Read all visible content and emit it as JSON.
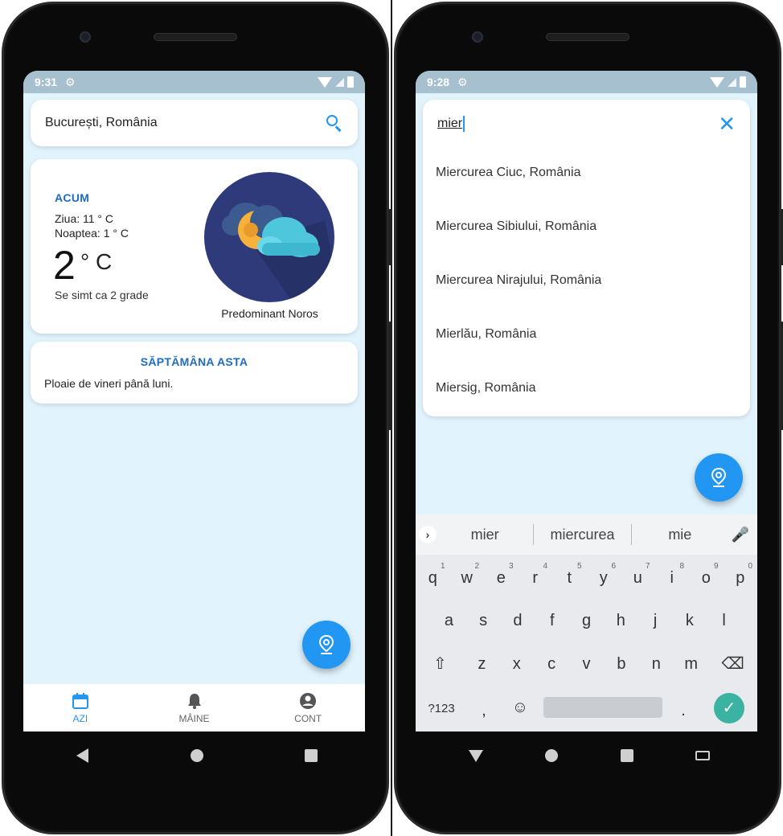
{
  "left_phone": {
    "status": {
      "time": "9:31"
    },
    "search": {
      "location": "București, România"
    },
    "now": {
      "heading": "ACUM",
      "day": "Ziua: 11 ° C",
      "night": "Noaptea: 1 ° C",
      "temp": "2",
      "unit": "° C",
      "feels_like": "Se simt ca 2 grade",
      "condition": "Predominant Noros"
    },
    "week": {
      "heading": "SĂPTĂMÂNA ASTA",
      "text": "Ploaie de vineri până luni."
    },
    "bottom_nav": [
      {
        "label": "AZI",
        "icon": "calendar-icon",
        "active": true
      },
      {
        "label": "MÂINE",
        "icon": "bell-icon",
        "active": false
      },
      {
        "label": "CONT",
        "icon": "account-icon",
        "active": false
      }
    ]
  },
  "right_phone": {
    "status": {
      "time": "9:28"
    },
    "search": {
      "query": "mier"
    },
    "suggestions": [
      "Miercurea Ciuc, România",
      "Miercurea Sibiului, România",
      "Miercurea Nirajului, România",
      "Mierlău, România",
      "Miersig, România"
    ],
    "keyboard": {
      "word_suggestions": [
        "mier",
        "miercurea",
        "mie"
      ],
      "row1": [
        "q",
        "w",
        "e",
        "r",
        "t",
        "y",
        "u",
        "i",
        "o",
        "p"
      ],
      "row1_hints": [
        "1",
        "2",
        "3",
        "4",
        "5",
        "6",
        "7",
        "8",
        "9",
        "0"
      ],
      "row2": [
        "a",
        "s",
        "d",
        "f",
        "g",
        "h",
        "j",
        "k",
        "l"
      ],
      "row3": [
        "z",
        "x",
        "c",
        "v",
        "b",
        "n",
        "m"
      ],
      "symbols_key": "?123",
      "comma_key": ",",
      "period_key": "."
    }
  },
  "colors": {
    "accent": "#2196f3",
    "heading_blue": "#1e6bc4",
    "screen_bg": "#e1f3fc",
    "statusbar": "#a7c0cf",
    "enter_key": "#3ab3a2"
  }
}
